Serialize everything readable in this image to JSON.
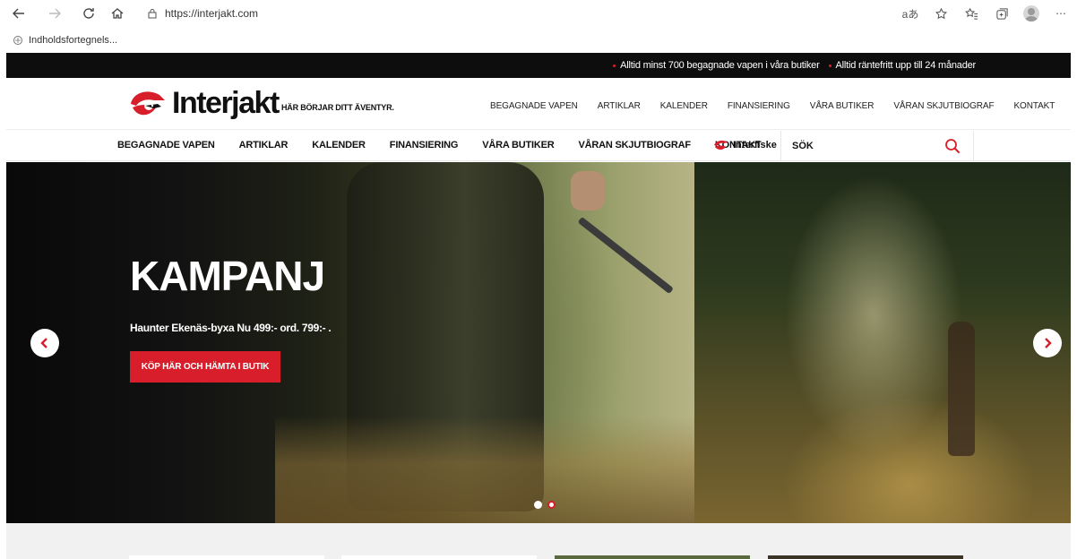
{
  "browser": {
    "url": "https://interjakt.com",
    "favorite_label": "Indholdsfortegnels...",
    "read_aloud_label": "aあ"
  },
  "promo": {
    "items": [
      "Alltid minst 700 begagnade vapen i våra butiker",
      "Alltid räntefritt upp till 24 månader"
    ]
  },
  "header": {
    "logo_text": "Interjakt",
    "tagline": "HÄR BÖRJAR DITT ÄVENTYR.",
    "top_links": [
      "BEGAGNADE VAPEN",
      "ARTIKLAR",
      "KALENDER",
      "FINANSIERING",
      "VÅRA BUTIKER",
      "VÅRAN SKJUTBIOGRAF",
      "KONTAKT"
    ]
  },
  "nav": {
    "items": [
      "BEGAGNADE VAPEN",
      "ARTIKLAR",
      "KALENDER",
      "FINANSIERING",
      "VÅRA BUTIKER",
      "VÅRAN SKJUTBIOGRAF",
      "KONTAKT"
    ],
    "interfiske_label": "Interfiske",
    "search_label": "SÖK"
  },
  "hero": {
    "title": "KAMPANJ",
    "subtitle": "Haunter Ekenäs-byxa Nu 499:- ord. 799:- .",
    "cta_label": "KÖP HÄR OCH HÄMTA I BUTIK",
    "active_slide": 2,
    "slide_count": 2
  },
  "colors": {
    "accent": "#d71e2a",
    "strip": "#0d0d0d"
  }
}
